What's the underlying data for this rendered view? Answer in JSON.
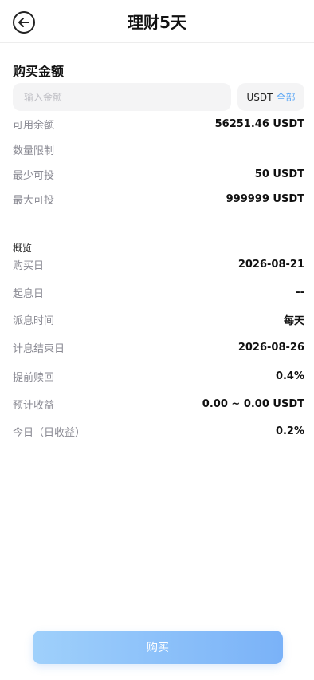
{
  "header": {
    "title": "理财5天",
    "back_icon": "arrow-left-icon"
  },
  "amount": {
    "section_title": "购买金额",
    "input_placeholder": "输入金额",
    "input_value": "",
    "unit": "USDT",
    "all_label": "全部"
  },
  "limits": [
    {
      "label": "可用余额",
      "value": "56251.46 USDT"
    },
    {
      "label": "数量限制",
      "value": ""
    },
    {
      "label": "最少可投",
      "value": "50 USDT"
    },
    {
      "label": "最大可投",
      "value": "999999 USDT"
    }
  ],
  "overview": {
    "title": "概览",
    "rows": [
      {
        "label": "购买日",
        "value": "2026-08-21"
      },
      {
        "label": "起息日",
        "value": "--"
      },
      {
        "label": "派息时间",
        "value": "每天"
      },
      {
        "label": "计息结束日",
        "value": "2026-08-26"
      },
      {
        "label": "提前赎回",
        "value": "0.4%"
      },
      {
        "label": "预计收益",
        "value": "0.00 ~ 0.00 USDT"
      },
      {
        "label": "今日（日收益）",
        "value": "0.2%"
      }
    ]
  },
  "buy_button_label": "购买",
  "colors": {
    "accent": "#5aa6f5",
    "button_start": "#9fd0fb",
    "button_end": "#7ab2f8",
    "label_gray": "#8a8a93"
  }
}
